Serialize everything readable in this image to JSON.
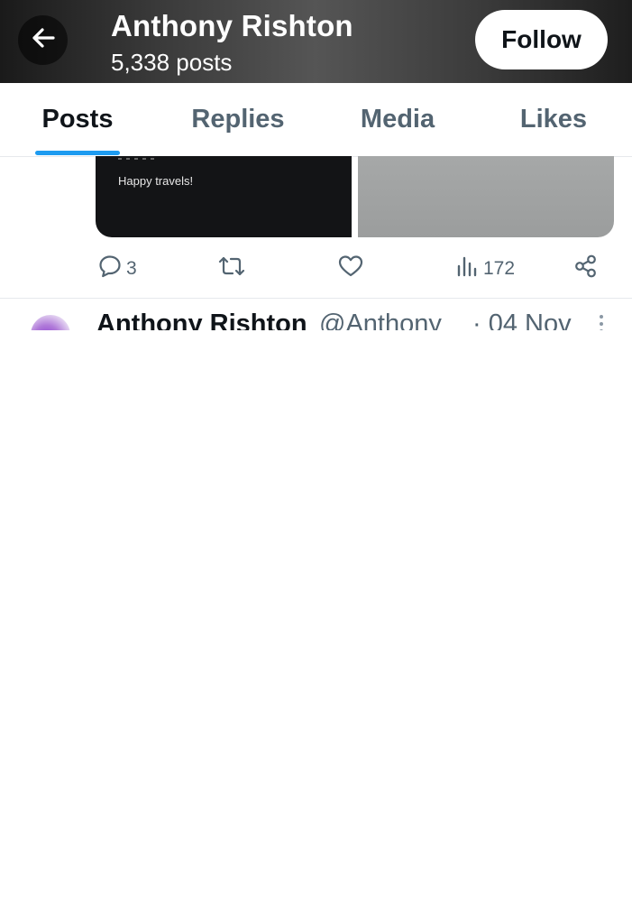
{
  "header": {
    "name": "Anthony Rishton",
    "posts_count": "5,338 posts",
    "follow_label": "Follow"
  },
  "tabs": [
    {
      "label": "Posts",
      "active": true
    },
    {
      "label": "Replies",
      "active": false
    },
    {
      "label": "Media",
      "active": false
    },
    {
      "label": "Likes",
      "active": false
    }
  ],
  "post": {
    "media_text": "Happy travels!",
    "actions": {
      "replies": "3",
      "views": "172"
    }
  },
  "next_post": {
    "name": "Anthony Rishton",
    "handle": "@Anthony",
    "date": "· 04 Nov"
  },
  "colors": {
    "accent": "#1d9bf0",
    "text_primary": "#0f1419",
    "text_secondary": "#536471"
  },
  "icons": [
    "back-arrow-icon",
    "reply-icon",
    "retweet-icon",
    "like-icon",
    "views-icon",
    "share-icon",
    "more-icon"
  ]
}
